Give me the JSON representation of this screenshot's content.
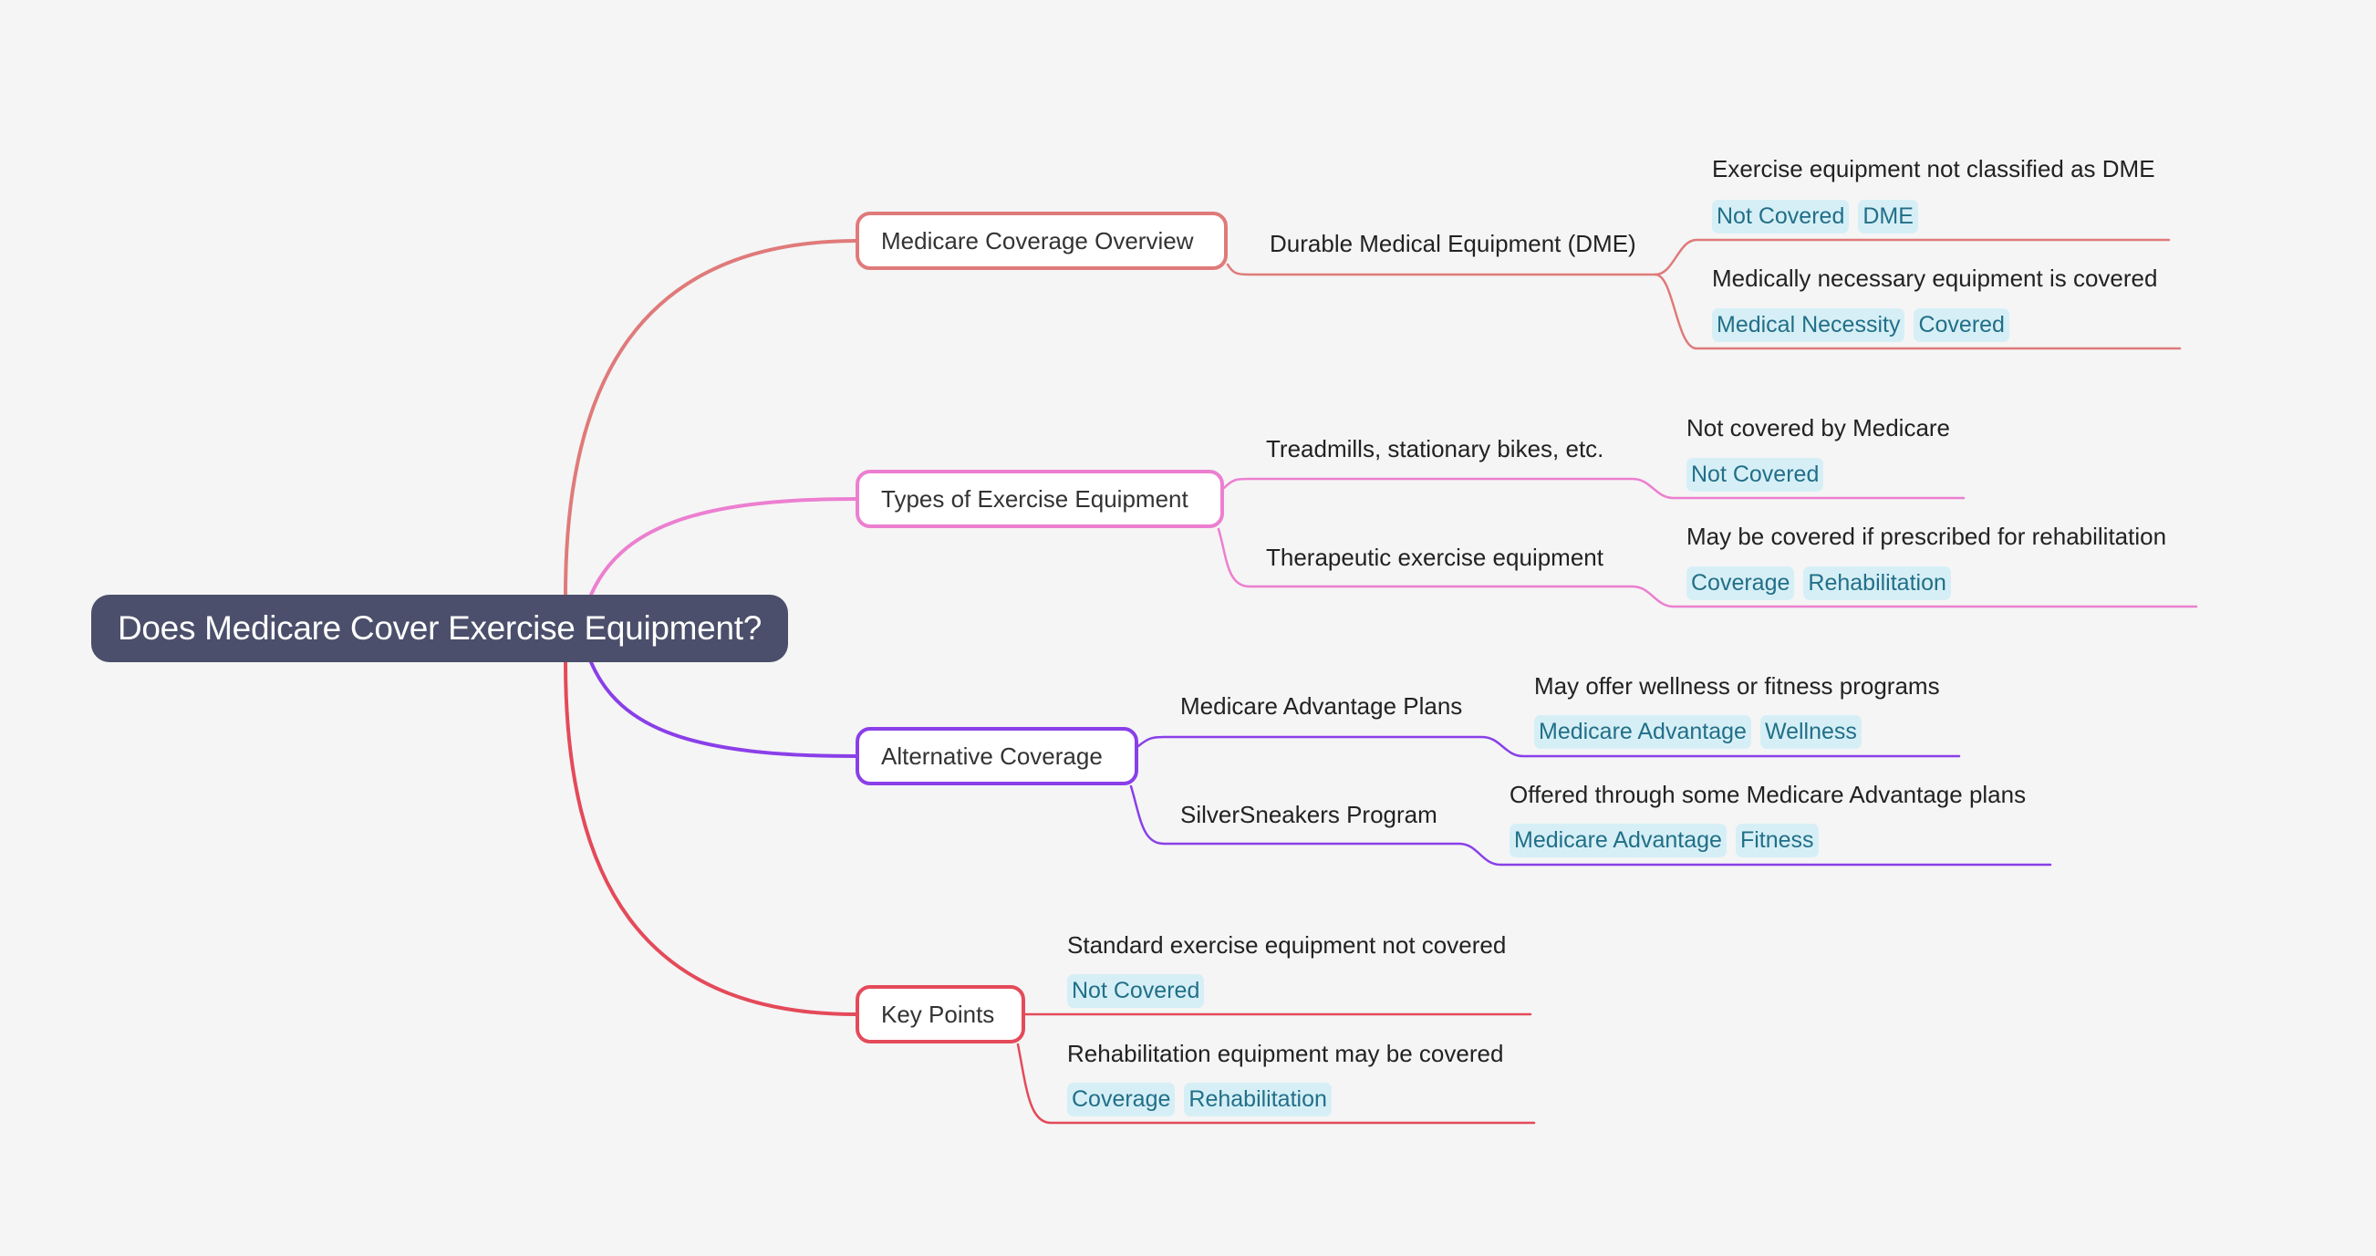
{
  "root": {
    "title": "Does Medicare Cover Exercise Equipment?"
  },
  "colors": {
    "background": "#f5f5f5",
    "root_fill": "#4b4f6b",
    "tag_fill": "#d6eff6",
    "tag_text": "#226f88",
    "branch_overview": "#e07a7a",
    "branch_types": "#ec7fd0",
    "branch_alternative": "#8a3fe8",
    "branch_keypoints": "#e44a5a"
  },
  "branches": [
    {
      "label": "Medicare Coverage Overview",
      "color": "#e07a7a",
      "children": [
        {
          "label": "Durable Medical Equipment (DME)",
          "children": [
            {
              "text": "Exercise equipment not classified as DME",
              "tags": [
                "Not Covered",
                "DME"
              ]
            },
            {
              "text": "Medically necessary equipment is covered",
              "tags": [
                "Medical Necessity",
                "Covered"
              ]
            }
          ]
        }
      ]
    },
    {
      "label": "Types of Exercise Equipment",
      "color": "#ec7fd0",
      "children": [
        {
          "label": "Treadmills, stationary bikes, etc.",
          "children": [
            {
              "text": "Not covered by Medicare",
              "tags": [
                "Not Covered"
              ]
            }
          ]
        },
        {
          "label": "Therapeutic exercise equipment",
          "children": [
            {
              "text": "May be covered if prescribed for rehabilitation",
              "tags": [
                "Coverage",
                "Rehabilitation"
              ]
            }
          ]
        }
      ]
    },
    {
      "label": "Alternative Coverage",
      "color": "#8a3fe8",
      "children": [
        {
          "label": "Medicare Advantage Plans",
          "children": [
            {
              "text": "May offer wellness or fitness programs",
              "tags": [
                "Medicare Advantage",
                "Wellness"
              ]
            }
          ]
        },
        {
          "label": "SilverSneakers Program",
          "children": [
            {
              "text": "Offered through some Medicare Advantage plans",
              "tags": [
                "Medicare Advantage",
                "Fitness"
              ]
            }
          ]
        }
      ]
    },
    {
      "label": "Key Points",
      "color": "#e44a5a",
      "children": [
        {
          "text": "Standard exercise equipment not covered",
          "tags": [
            "Not Covered"
          ]
        },
        {
          "text": "Rehabilitation equipment may be covered",
          "tags": [
            "Coverage",
            "Rehabilitation"
          ]
        }
      ]
    }
  ]
}
